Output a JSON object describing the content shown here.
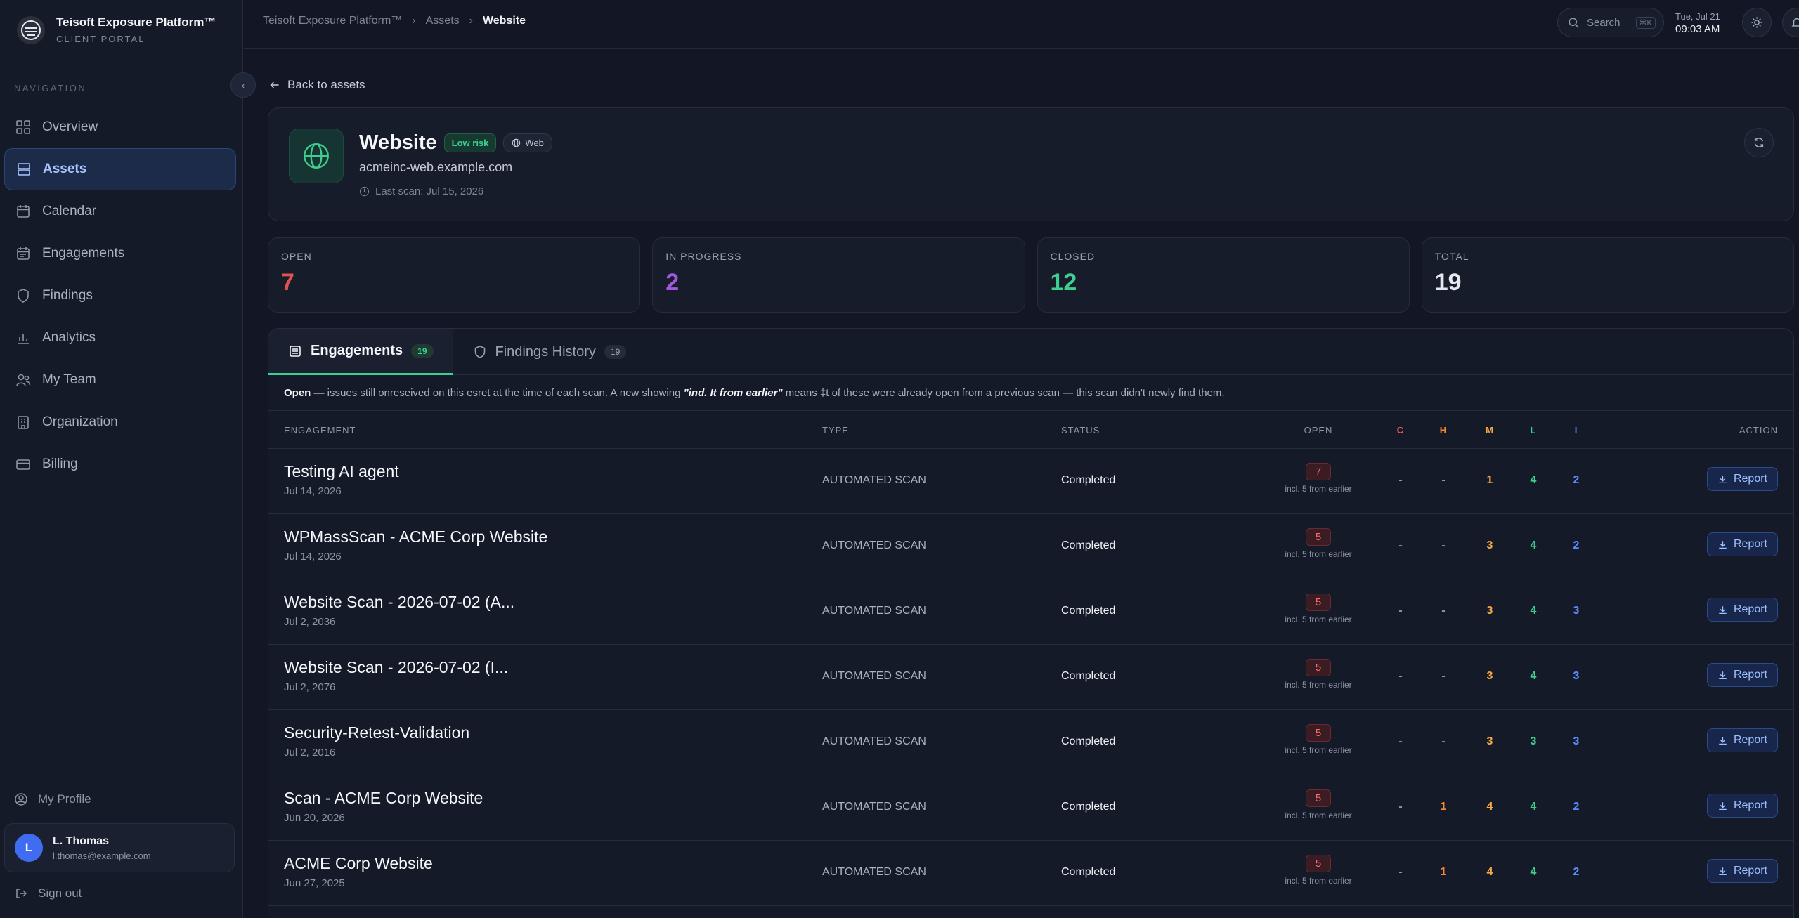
{
  "brand": {
    "title": "Teisoft Exposure Platform™",
    "subtitle": "CLIENT PORTAL"
  },
  "sidebar": {
    "heading": "NAVIGATION",
    "collapse_glyph": "‹",
    "items": [
      {
        "label": "Overview",
        "icon": "grid-icon"
      },
      {
        "label": "Assets",
        "icon": "layers-icon",
        "active": true
      },
      {
        "label": "Calendar",
        "icon": "calendar-icon"
      },
      {
        "label": "Engagements",
        "icon": "calendar-list-icon"
      },
      {
        "label": "Findings",
        "icon": "shield-icon"
      },
      {
        "label": "Analytics",
        "icon": "bar-chart-icon"
      },
      {
        "label": "My Team",
        "icon": "users-icon"
      },
      {
        "label": "Organization",
        "icon": "building-icon"
      },
      {
        "label": "Billing",
        "icon": "card-icon"
      }
    ],
    "profile_label": "My Profile",
    "user": {
      "initial": "L",
      "name": "L. Thomas",
      "email": "l.thomas@example.com"
    },
    "signout_label": "Sign out"
  },
  "topbar": {
    "breadcrumb": [
      "Teisoft Exposure Platform™",
      "Assets",
      "Website"
    ],
    "search_label": "Search",
    "search_shortcut": "⌘K",
    "date": "Tue, Jul 21",
    "time": "09:03 AM"
  },
  "back_label": "Back to assets",
  "asset": {
    "name": "Website",
    "risk_badge": "Low risk",
    "type_badge": "Web",
    "host": "acmeinc-web.example.com",
    "last_scan": "Last scan: Jul 15, 2026"
  },
  "stats": [
    {
      "label": "OPEN",
      "value": "7",
      "color": "#e05252"
    },
    {
      "label": "IN PROGRESS",
      "value": "2",
      "color": "#a259e0"
    },
    {
      "label": "CLOSED",
      "value": "12",
      "color": "#3ecf8e"
    },
    {
      "label": "TOTAL",
      "value": "19",
      "color": "#e6e8ef"
    }
  ],
  "tabs": [
    {
      "label": "Engagements",
      "count": "19",
      "active": true
    },
    {
      "label": "Findings History",
      "count": "19",
      "active": false
    }
  ],
  "note": {
    "lead": "Open —",
    "text1": " issues still onreseived on this esret at the time of each scan. A new showing ",
    "emph": "\"ind. It from earlier\"",
    "text2": " means ‡t of these were already open from a previous scan — this scan didn't newly find them."
  },
  "table": {
    "headers": {
      "engagement": "ENGAGEMENT",
      "type": "TYPE",
      "status": "STATUS",
      "open": "OPEN",
      "c": "C",
      "h": "H",
      "m": "M",
      "l": "L",
      "i": "I",
      "action": "ACTION"
    },
    "severity_colors": {
      "c": "#ff5a5a",
      "h": "#f28b30",
      "m": "#f5a742",
      "l": "#3ecf8e",
      "i": "#5b8cff",
      "dash": "#8e96a6"
    },
    "rows": [
      {
        "name": "Testing AI agent",
        "date": "Jul 14, 2026",
        "type": "AUTOMATED SCAN",
        "status": "Completed",
        "open": "7",
        "open_sub": "incl. 5 from earlier",
        "c": "-",
        "h": "-",
        "m": "1",
        "l": "4",
        "i": "2",
        "action": "Report"
      },
      {
        "name": "WPMassScan - ACME Corp Website",
        "date": "Jul 14, 2026",
        "type": "AUTOMATED SCAN",
        "status": "Completed",
        "open": "5",
        "open_sub": "incl. 5 from earlier",
        "c": "-",
        "h": "-",
        "m": "3",
        "l": "4",
        "i": "2",
        "action": "Report"
      },
      {
        "name": "Website Scan - 2026-07-02 (A...",
        "date": "Jul 2, 2036",
        "type": "AUTOMATED SCAN",
        "status": "Completed",
        "open": "5",
        "open_sub": "incl. 5 from earlier",
        "c": "-",
        "h": "-",
        "m": "3",
        "l": "4",
        "i": "3",
        "action": "Report"
      },
      {
        "name": "Website Scan - 2026-07-02 (I...",
        "date": "Jul 2, 2076",
        "type": "AUTOMATED SCAN",
        "status": "Completed",
        "open": "5",
        "open_sub": "incl. 5 from earlier",
        "c": "-",
        "h": "-",
        "m": "3",
        "l": "4",
        "i": "3",
        "action": "Report"
      },
      {
        "name": "Security-Retest-Validation",
        "date": "Jul 2, 2016",
        "type": "AUTOMATED SCAN",
        "status": "Completed",
        "open": "5",
        "open_sub": "incl. 5 from earlier",
        "c": "-",
        "h": "-",
        "m": "3",
        "l": "3",
        "i": "3",
        "action": "Report"
      },
      {
        "name": "Scan - ACME Corp Website",
        "date": "Jun 20, 2026",
        "type": "AUTOMATED SCAN",
        "status": "Completed",
        "open": "5",
        "open_sub": "incl. 5 from earlier",
        "c": "-",
        "h": "1",
        "m": "4",
        "l": "4",
        "i": "2",
        "action": "Report"
      },
      {
        "name": "ACME Corp Website",
        "date": "Jun 27, 2025",
        "type": "AUTOMATED SCAN",
        "status": "Completed",
        "open": "5",
        "open_sub": "incl. 5 from earlier",
        "c": "-",
        "h": "1",
        "m": "4",
        "l": "4",
        "i": "2",
        "action": "Report"
      }
    ]
  }
}
